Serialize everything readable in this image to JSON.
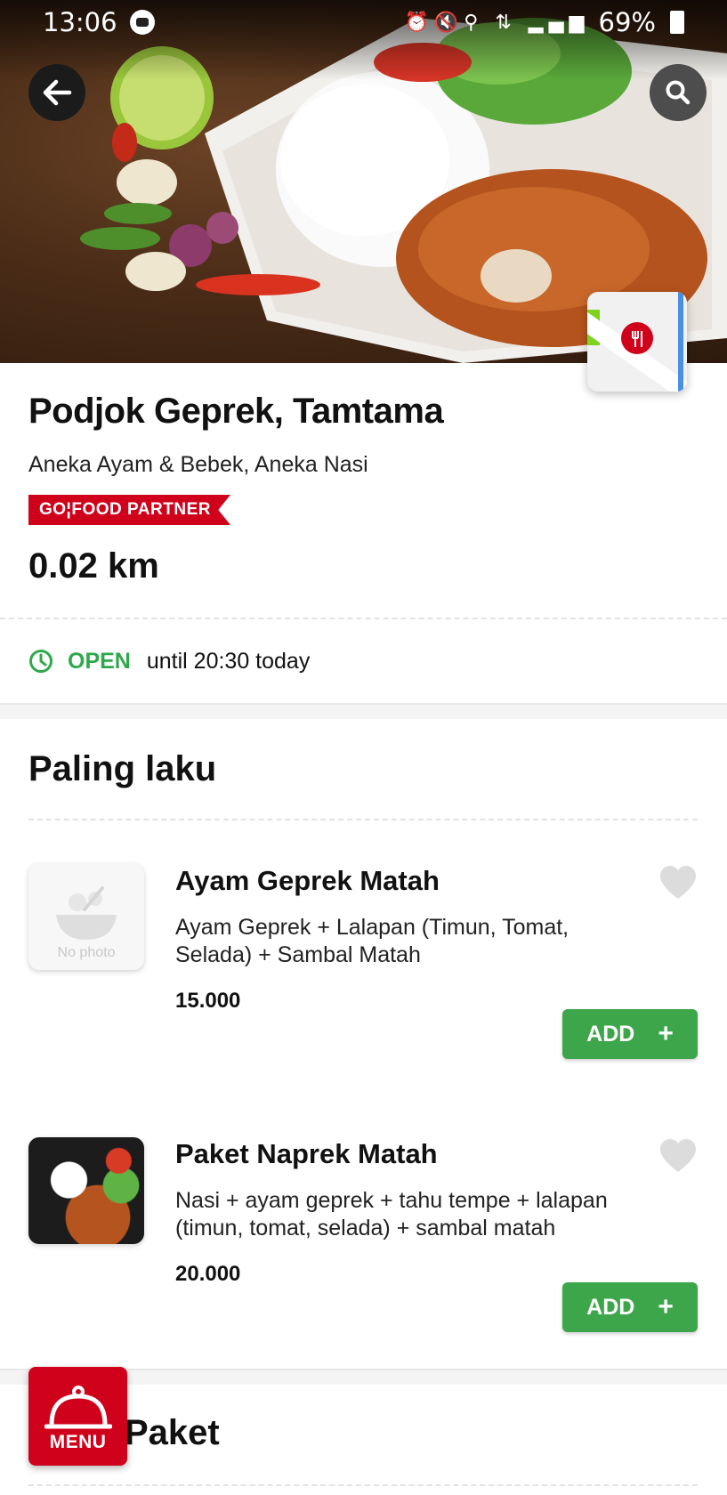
{
  "status_bar": {
    "time": "13:06",
    "battery": "69%"
  },
  "restaurant": {
    "name": "Podjok Geprek, Tamtama",
    "categories": "Aneka Ayam & Bebek, Aneka Nasi",
    "badge": "GO¦FOOD PARTNER",
    "distance": "0.02 km",
    "open_status": "OPEN",
    "open_until": "until 20:30 today"
  },
  "sections": [
    {
      "title": "Paling laku",
      "items": [
        {
          "name": "Ayam Geprek Matah",
          "description": "Ayam Geprek + Lalapan (Timun, Tomat, Selada) + Sambal Matah",
          "price": "15.000",
          "add_label": "ADD",
          "photo_text": "No photo"
        },
        {
          "name": "Paket Naprek Matah",
          "description": "Nasi + ayam geprek + tahu tempe + lalapan (timun, tomat, selada) + sambal matah",
          "price": "20.000",
          "add_label": "ADD"
        }
      ]
    },
    {
      "title": "Paket"
    }
  ],
  "menu_button": {
    "label": "MENU"
  },
  "colors": {
    "brand_red": "#d0021b",
    "open_green": "#2ea84b",
    "add_green": "#3ea64a"
  },
  "icons": [
    "back-arrow-icon",
    "search-icon",
    "map-pin-icon",
    "clock-icon",
    "heart-icon",
    "plus-icon",
    "cloche-icon"
  ]
}
